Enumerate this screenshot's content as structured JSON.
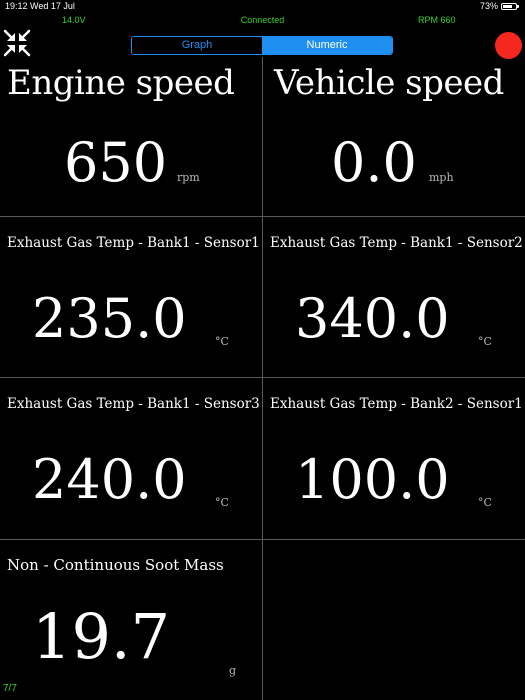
{
  "status_bar": {
    "time_date": "19:12  Wed 17 Jul",
    "battery_pct": "73%",
    "battery_level": 0.73
  },
  "info_line": {
    "voltage": "14.0V",
    "connection": "Connected",
    "rpm": "RPM 660"
  },
  "tabs": [
    {
      "label": "Graph",
      "selected": false
    },
    {
      "label": "Numeric",
      "selected": true
    }
  ],
  "colors": {
    "accent": "#1f8ef1",
    "status_green": "#36d12a",
    "record_red": "#f5271f"
  },
  "gauges": [
    {
      "label": "Engine speed",
      "value": "650",
      "unit": "rpm"
    },
    {
      "label": "Vehicle speed",
      "value": "0.0",
      "unit": "mph"
    },
    {
      "label": "Exhaust Gas Temp - Bank1 - Sensor1",
      "value": "235.0",
      "unit": "°C"
    },
    {
      "label": "Exhaust Gas Temp - Bank1 - Sensor2",
      "value": "340.0",
      "unit": "°C"
    },
    {
      "label": "Exhaust Gas Temp - Bank1 - Sensor3",
      "value": "240.0",
      "unit": "°C"
    },
    {
      "label": "Exhaust Gas Temp - Bank2 - Sensor1",
      "value": "100.0",
      "unit": "°C"
    },
    {
      "label": "Non - Continuous Soot Mass",
      "value": "19.7",
      "unit": "g"
    }
  ],
  "page_indicator": "7/7"
}
